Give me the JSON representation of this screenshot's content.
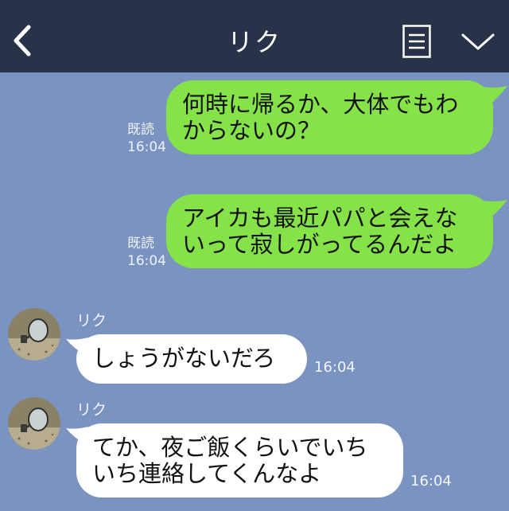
{
  "header": {
    "title": "リク",
    "background": "#283249"
  },
  "colors": {
    "chat_background": "#7b93c0",
    "sent_bubble": "#85e248",
    "received_bubble": "#ffffff"
  },
  "messages": [
    {
      "direction": "sent",
      "text": "何時に帰るか、大体でもわ\nからないの？",
      "read_label": "既読",
      "time": "16:04"
    },
    {
      "direction": "sent",
      "text": "アイカも最近パパと会えな\nいって寂しがってるんだよ",
      "read_label": "既読",
      "time": "16:04"
    },
    {
      "direction": "received",
      "sender": "リク",
      "text": "しょうがないだろ",
      "time": "16:04"
    },
    {
      "direction": "received",
      "sender": "リク",
      "text": "てか、夜ご飯くらいでいち\nいち連絡してくんなよ",
      "time": "16:04"
    }
  ]
}
